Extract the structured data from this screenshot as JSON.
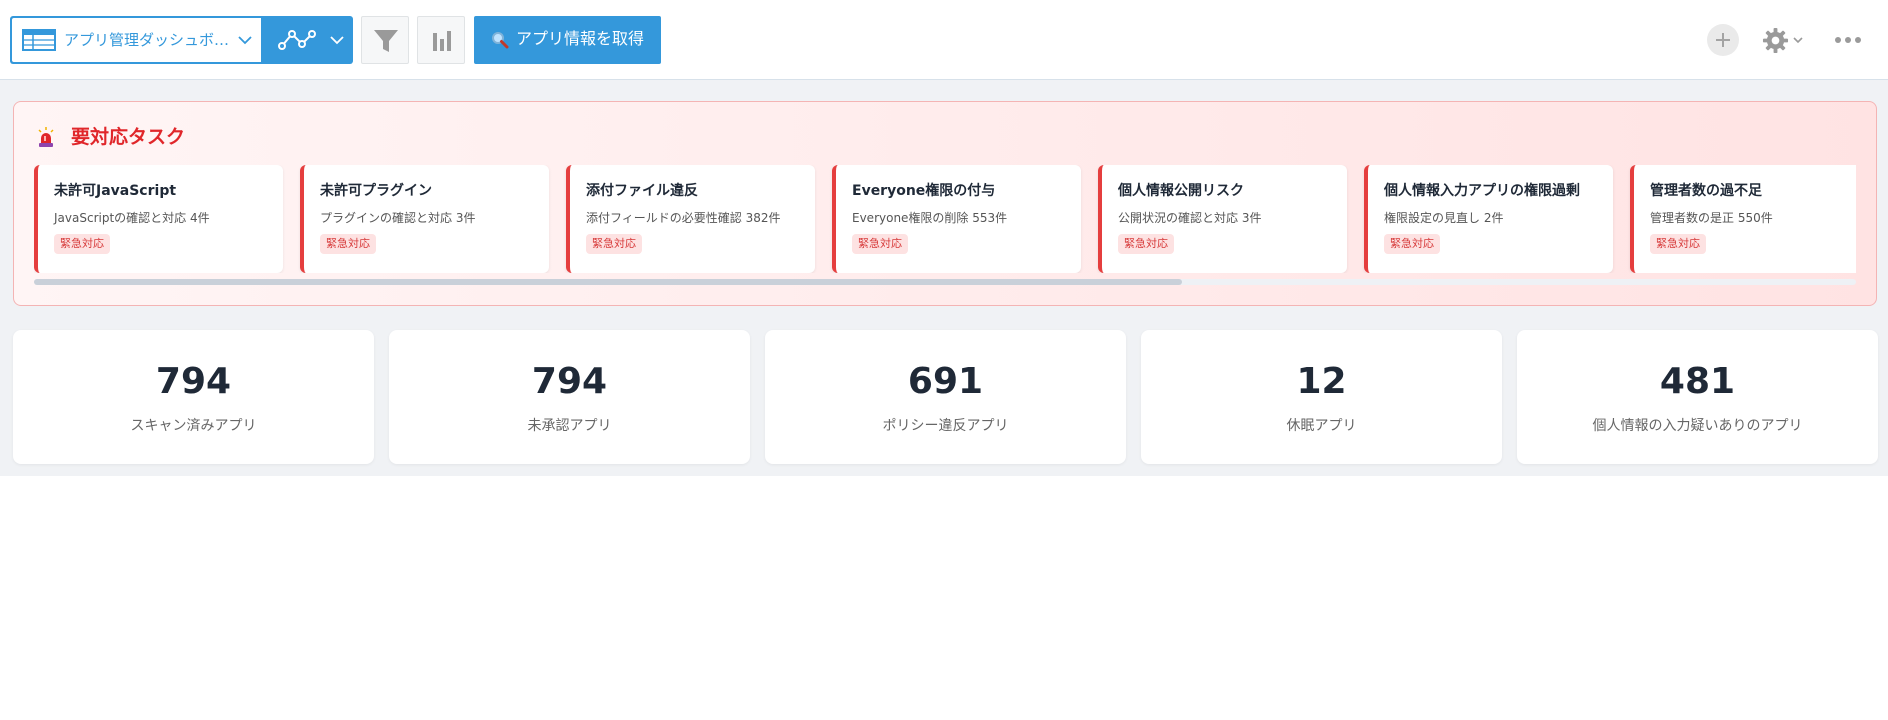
{
  "toolbar": {
    "view_name": "アプリ管理ダッシュボ…",
    "fetch_label": "アプリ情報を取得",
    "accent_color": "#3498db",
    "icons": [
      "table-icon",
      "chevron-down-icon",
      "graph-icon",
      "filter-icon",
      "bar-chart-icon",
      "search-icon",
      "plus-icon",
      "gear-icon",
      "more-icon"
    ]
  },
  "alert": {
    "title": "要対応タスク",
    "icon": "siren-icon",
    "accent_color": "#e0262a",
    "tasks": [
      {
        "title": "未許可JavaScript",
        "desc": "JavaScriptの確認と対応 4件",
        "badge": "緊急対応"
      },
      {
        "title": "未許可プラグイン",
        "desc": "プラグインの確認と対応 3件",
        "badge": "緊急対応"
      },
      {
        "title": "添付ファイル違反",
        "desc": "添付フィールドの必要性確認 382件",
        "badge": "緊急対応"
      },
      {
        "title": "Everyone権限の付与",
        "desc": "Everyone権限の削除 553件",
        "badge": "緊急対応"
      },
      {
        "title": "個人情報公開リスク",
        "desc": "公開状況の確認と対応 3件",
        "badge": "緊急対応"
      },
      {
        "title": "個人情報入力アプリの権限過剰",
        "desc": "権限設定の見直し 2件",
        "badge": "緊急対応"
      },
      {
        "title": "管理者数の過不足",
        "desc": "管理者数の是正 550件",
        "badge": "緊急対応"
      }
    ],
    "scroll_fraction": 0.63
  },
  "stats": [
    {
      "value": "794",
      "label": "スキャン済みアプリ"
    },
    {
      "value": "794",
      "label": "未承認アプリ"
    },
    {
      "value": "691",
      "label": "ポリシー違反アプリ"
    },
    {
      "value": "12",
      "label": "休眠アプリ"
    },
    {
      "value": "481",
      "label": "個人情報の入力疑いありのアプリ"
    }
  ]
}
